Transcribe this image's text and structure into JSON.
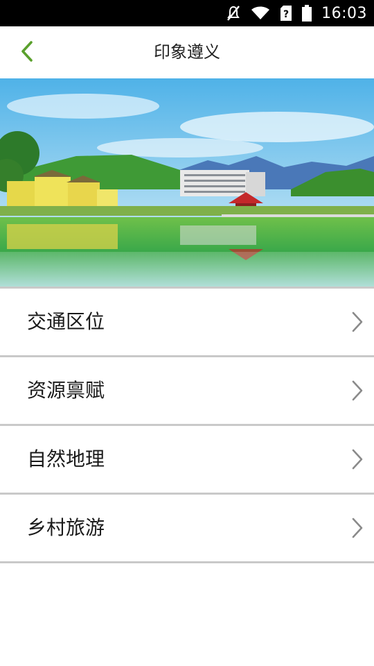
{
  "status_bar": {
    "time": "16:03",
    "icons": [
      "mute-icon",
      "wifi-icon",
      "sim-unknown-icon",
      "battery-icon"
    ]
  },
  "app_bar": {
    "title": "印象遵义",
    "back_icon": "chevron-left-icon",
    "accent_color": "#5aa02c"
  },
  "banner": {
    "description_icon": "scenic-town-lake-photo"
  },
  "menu": {
    "items": [
      {
        "label": "交通区位",
        "icon": "chevron-right-icon"
      },
      {
        "label": "资源禀赋",
        "icon": "chevron-right-icon"
      },
      {
        "label": "自然地理",
        "icon": "chevron-right-icon"
      },
      {
        "label": "乡村旅游",
        "icon": "chevron-right-icon"
      }
    ]
  }
}
